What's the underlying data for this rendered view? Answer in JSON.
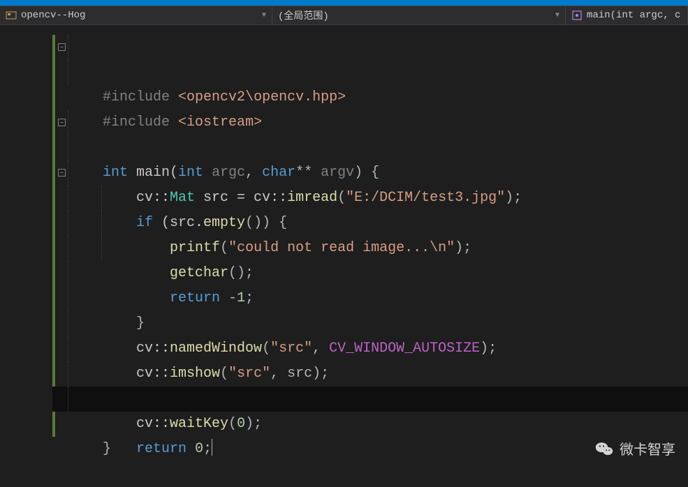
{
  "navbar": {
    "project": "opencv--Hog",
    "scope": "(全局范围)",
    "function": "main(int argc, c"
  },
  "code": {
    "l1_pre": "#include ",
    "l1_inc": "<opencv2\\opencv.hpp>",
    "l2_pre": "#include ",
    "l2_inc": "<iostream>",
    "l4_int": "int",
    "l4_main": " main(",
    "l4_int2": "int",
    "l4_argc": " argc",
    "l4_comma": ", ",
    "l4_char": "char",
    "l4_stars": "**",
    "l4_argv": " argv",
    "l4_end": ") {",
    "l5_a": "    cv::",
    "l5_mat": "Mat",
    "l5_b": " src = cv::",
    "l5_imread": "imread",
    "l5_c": "(",
    "l5_str": "\"E:/DCIM/test3.jpg\"",
    "l5_d": ");",
    "l6_if": "    if ",
    "l6_a": "(src.",
    "l6_empty": "empty",
    "l6_b": "()) {",
    "l7_a": "        ",
    "l7_printf": "printf",
    "l7_b": "(",
    "l7_str": "\"could not read image...\\n\"",
    "l7_c": ");",
    "l8_a": "        ",
    "l8_getchar": "getchar",
    "l8_b": "();",
    "l9_a": "        ",
    "l9_return": "return",
    "l9_b": " -",
    "l9_num": "1",
    "l9_c": ";",
    "l10": "    }",
    "l11_a": "    cv::",
    "l11_named": "namedWindow",
    "l11_b": "(",
    "l11_str": "\"src\"",
    "l11_c": ", ",
    "l11_macro": "CV_WINDOW_AUTOSIZE",
    "l11_d": ");",
    "l12_a": "    cv::",
    "l12_imshow": "imshow",
    "l12_b": "(",
    "l12_str": "\"src\"",
    "l12_c": ", src);",
    "l14_a": "    cv::",
    "l14_wait": "waitKey",
    "l14_b": "(",
    "l14_num": "0",
    "l14_c": ");",
    "l15_a": "    ",
    "l15_return": "return",
    "l15_b": " ",
    "l15_num": "0",
    "l15_c": ";",
    "l16": "}"
  },
  "watermark": "微卡智享"
}
